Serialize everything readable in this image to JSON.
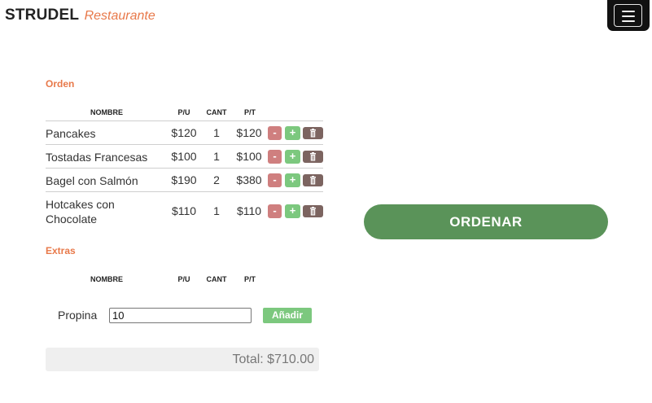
{
  "brand": {
    "name": "STRUDEL",
    "subtitle": "Restaurante"
  },
  "orden": {
    "title": "Orden",
    "headers": {
      "nombre": "NOMBRE",
      "pu": "P/U",
      "cant": "CANT",
      "pt": "P/T"
    },
    "items": [
      {
        "name": "Pancakes",
        "pu": "$120",
        "cant": "1",
        "pt": "$120"
      },
      {
        "name": "Tostadas Francesas",
        "pu": "$100",
        "cant": "1",
        "pt": "$100"
      },
      {
        "name": "Bagel con Salmón",
        "pu": "$190",
        "cant": "2",
        "pt": "$380"
      },
      {
        "name": "Hotcakes con Chocolate",
        "pu": "$110",
        "cant": "1",
        "pt": "$110"
      }
    ],
    "minus_label": "-",
    "plus_label": "+"
  },
  "extras": {
    "title": "Extras",
    "headers": {
      "nombre": "NOMBRE",
      "pu": "P/U",
      "cant": "CANT",
      "pt": "P/T"
    }
  },
  "propina": {
    "label": "Propina",
    "value": "10",
    "add_label": "Añadir"
  },
  "total": {
    "text": "Total: $710.00"
  },
  "order_button": {
    "label": "ORDENAR"
  },
  "colors": {
    "accent": "#e8794a",
    "order_green": "#5a9359",
    "plus_green": "#7cc87e",
    "minus_red": "#cf7f7f",
    "delete_brown": "#7c6460"
  },
  "icons": {
    "menu": "hamburger-menu-icon",
    "delete": "trash-icon"
  }
}
